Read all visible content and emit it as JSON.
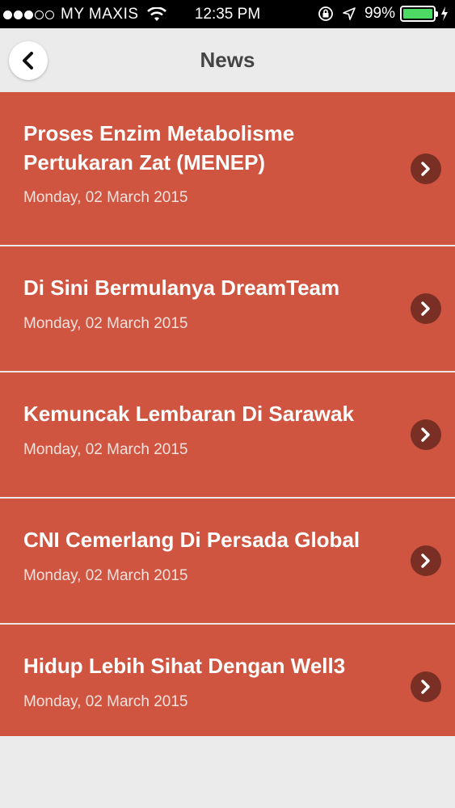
{
  "status_bar": {
    "carrier": "MY MAXIS",
    "time": "12:35 PM",
    "battery_percent": "99%",
    "battery_level": 0.99,
    "signal_dots_filled": 3,
    "signal_dots_total": 5,
    "icons": [
      "wifi-icon",
      "orientation-lock-icon",
      "location-arrow-icon",
      "battery-icon",
      "charging-bolt-icon"
    ]
  },
  "nav": {
    "title": "News",
    "back_icon": "chevron-left-icon"
  },
  "news": [
    {
      "title": "Proses Enzim Metabolisme Pertukaran Zat (MENEP)",
      "date": "Monday, 02 March 2015"
    },
    {
      "title": "Di Sini Bermulanya DreamTeam",
      "date": "Monday, 02 March 2015"
    },
    {
      "title": "Kemuncak Lembaran Di Sarawak",
      "date": "Monday, 02 March 2015"
    },
    {
      "title": "CNI Cemerlang Di Persada Global",
      "date": "Monday, 02 March 2015"
    },
    {
      "title": "Hidup Lebih Sihat Dengan Well3",
      "date": "Monday, 02 March 2015"
    }
  ],
  "colors": {
    "item_background": "#cf5541",
    "chevron_circle": "#7a2f25",
    "nav_background": "#ebebeb",
    "battery_green": "#4cd964"
  }
}
